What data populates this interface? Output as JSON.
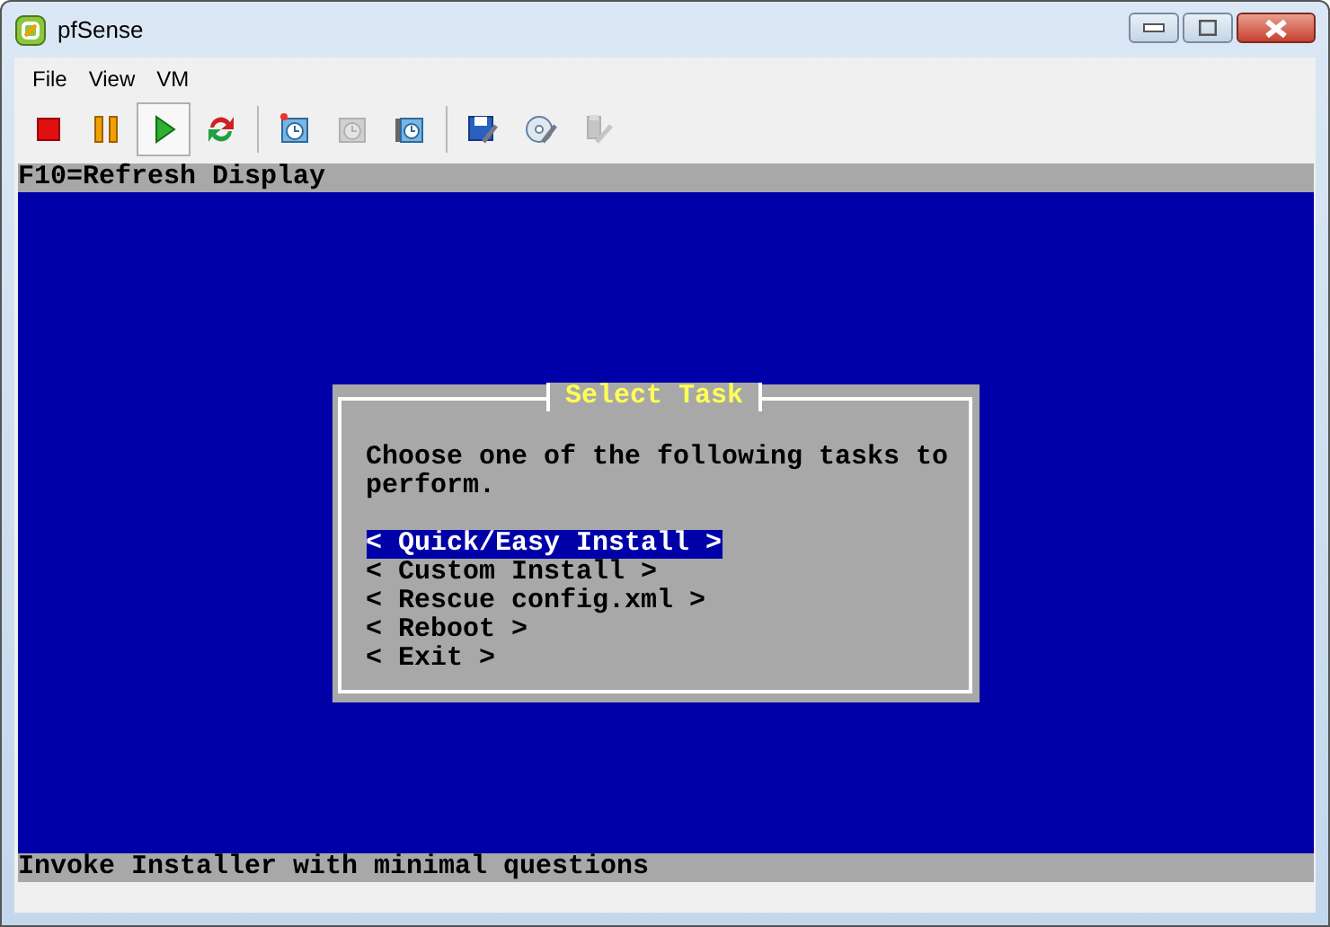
{
  "window": {
    "title": "pfSense"
  },
  "menu": [
    {
      "label": "File"
    },
    {
      "label": "View"
    },
    {
      "label": "VM"
    }
  ],
  "toolbar": [
    {
      "kind": "stop",
      "pressed": false,
      "disabled": false
    },
    {
      "kind": "pause",
      "pressed": false,
      "disabled": false
    },
    {
      "kind": "play",
      "pressed": true,
      "disabled": false
    },
    {
      "kind": "restart",
      "pressed": false,
      "disabled": false
    },
    {
      "kind": "separator"
    },
    {
      "kind": "snapshot",
      "pressed": false,
      "disabled": false
    },
    {
      "kind": "revert",
      "pressed": false,
      "disabled": true
    },
    {
      "kind": "manage",
      "pressed": false,
      "disabled": false
    },
    {
      "kind": "separator"
    },
    {
      "kind": "floppy",
      "pressed": false,
      "disabled": false
    },
    {
      "kind": "disc",
      "pressed": false,
      "disabled": false
    },
    {
      "kind": "usb",
      "pressed": false,
      "disabled": true
    }
  ],
  "console": {
    "top_bar": "F10=Refresh Display",
    "dialog": {
      "title": "Select Task",
      "prompt": "Choose one of the following tasks to perform.",
      "options": [
        {
          "label": "< Quick/Easy Install >",
          "selected": true
        },
        {
          "label": "< Custom Install >",
          "selected": false
        },
        {
          "label": "< Rescue config.xml >",
          "selected": false
        },
        {
          "label": "< Reboot >",
          "selected": false
        },
        {
          "label": "< Exit >",
          "selected": false
        }
      ]
    },
    "bottom_bar": "Invoke Installer with minimal questions"
  }
}
